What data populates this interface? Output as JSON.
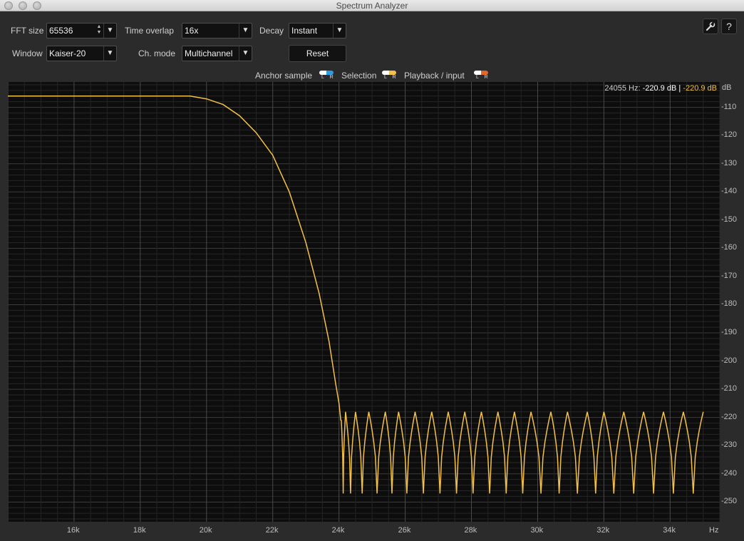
{
  "window": {
    "title": "Spectrum Analyzer"
  },
  "controls": {
    "fft_size": {
      "label": "FFT size",
      "value": "65536"
    },
    "time_overlap": {
      "label": "Time overlap",
      "value": "16x"
    },
    "decay": {
      "label": "Decay",
      "value": "Instant"
    },
    "window_fn": {
      "label": "Window",
      "value": "Kaiser-20"
    },
    "ch_mode": {
      "label": "Ch. mode",
      "value": "Multichannel"
    },
    "reset_label": "Reset"
  },
  "legend": [
    {
      "label": "Anchor sample",
      "colors": [
        "#ffffff",
        "#2f9be0"
      ]
    },
    {
      "label": "Selection",
      "colors": [
        "#ffffff",
        "#f2c04a"
      ]
    },
    {
      "label": "Playback / input",
      "colors": [
        "#ffffff",
        "#e0662a"
      ]
    }
  ],
  "lr_text": "L R",
  "readout": {
    "freq": "24055 Hz:",
    "left": "-220.9 dB",
    "sep": "|",
    "right": "-220.9 dB"
  },
  "chart_data": {
    "type": "line",
    "x_unit": "Hz",
    "y_unit": "dB",
    "xlim": [
      14000,
      35500
    ],
    "ylim": [
      -257,
      -101
    ],
    "x_ticks": [
      16000,
      18000,
      20000,
      22000,
      24000,
      26000,
      28000,
      30000,
      32000,
      34000
    ],
    "x_tick_labels": [
      "16k",
      "18k",
      "20k",
      "22k",
      "24k",
      "26k",
      "28k",
      "30k",
      "32k",
      "34k"
    ],
    "x_unit_label": "Hz",
    "y_ticks": [
      -110,
      -120,
      -130,
      -140,
      -150,
      -160,
      -170,
      -180,
      -190,
      -200,
      -210,
      -220,
      -230,
      -240,
      -250
    ],
    "y_tick_labels": [
      "-110",
      "-120",
      "-130",
      "-140",
      "-150",
      "-160",
      "-170",
      "-180",
      "-190",
      "-200",
      "-210",
      "-220",
      "-230",
      "-240",
      "-250"
    ],
    "y_unit_label": "dB",
    "grid": true,
    "series": [
      {
        "color": "#f2c04a",
        "x": [
          14000,
          18000,
          19500,
          20000,
          20500,
          21000,
          21500,
          22000,
          22500,
          23000,
          23400,
          23700,
          23900,
          24000,
          24055
        ],
        "y": [
          -106,
          -106,
          -106,
          -107,
          -109,
          -113,
          -119,
          -127,
          -140,
          -158,
          -176,
          -193,
          -208,
          -215,
          -221
        ],
        "stopband": {
          "lobe_peaks_x": [
            24200,
            24500,
            24900,
            25400,
            25800,
            26300,
            26800,
            27300,
            27800,
            28300,
            28800,
            29300,
            29800,
            30400,
            30900,
            31500,
            32000,
            32600,
            33200,
            33800,
            34400,
            35000
          ],
          "peak_db": -218,
          "null_db": -247
        }
      }
    ]
  }
}
